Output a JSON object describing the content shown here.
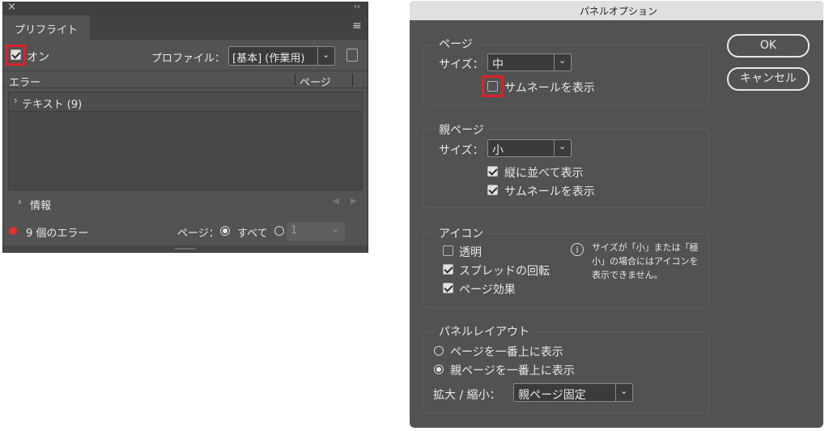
{
  "preflight": {
    "tab_label": "プリフライト",
    "on_label": "オン",
    "profile_label": "プロファイル：",
    "profile_value": "[基本] (作業用)",
    "col_error": "エラー",
    "col_page": "ページ",
    "error_row": "テキスト (9)",
    "info_label": "情報",
    "error_count": "9 個のエラー",
    "page_label": "ページ：",
    "page_all": "すべて",
    "page_number": "1",
    "status_color": "#e3312e"
  },
  "dialog": {
    "title": "パネルオプション",
    "ok_label": "OK",
    "cancel_label": "キャンセル",
    "page_group": {
      "title": "ページ",
      "size_label": "サイズ：",
      "size_value": "中",
      "show_thumbnails": "サムネールを表示"
    },
    "master_group": {
      "title": "親ページ",
      "size_label": "サイズ：",
      "size_value": "小",
      "show_vertical": "縦に並べて表示",
      "show_thumbnails": "サムネールを表示"
    },
    "icon_group": {
      "title": "アイコン",
      "transparency": "透明",
      "spread_rotation": "スプレッドの回転",
      "page_effects": "ページ効果",
      "note_line1": "サイズが「小」または「極",
      "note_line2": "小」の場合にはアイコンを",
      "note_line3": "表示できません。"
    },
    "layout_group": {
      "title": "パネルレイアウト",
      "pages_on_top": "ページを一番上に表示",
      "masters_on_top": "親ページを一番上に表示",
      "zoom_label": "拡大 / 縮小：",
      "zoom_value": "親ページ固定"
    }
  },
  "highlight_color": "#e0202a"
}
